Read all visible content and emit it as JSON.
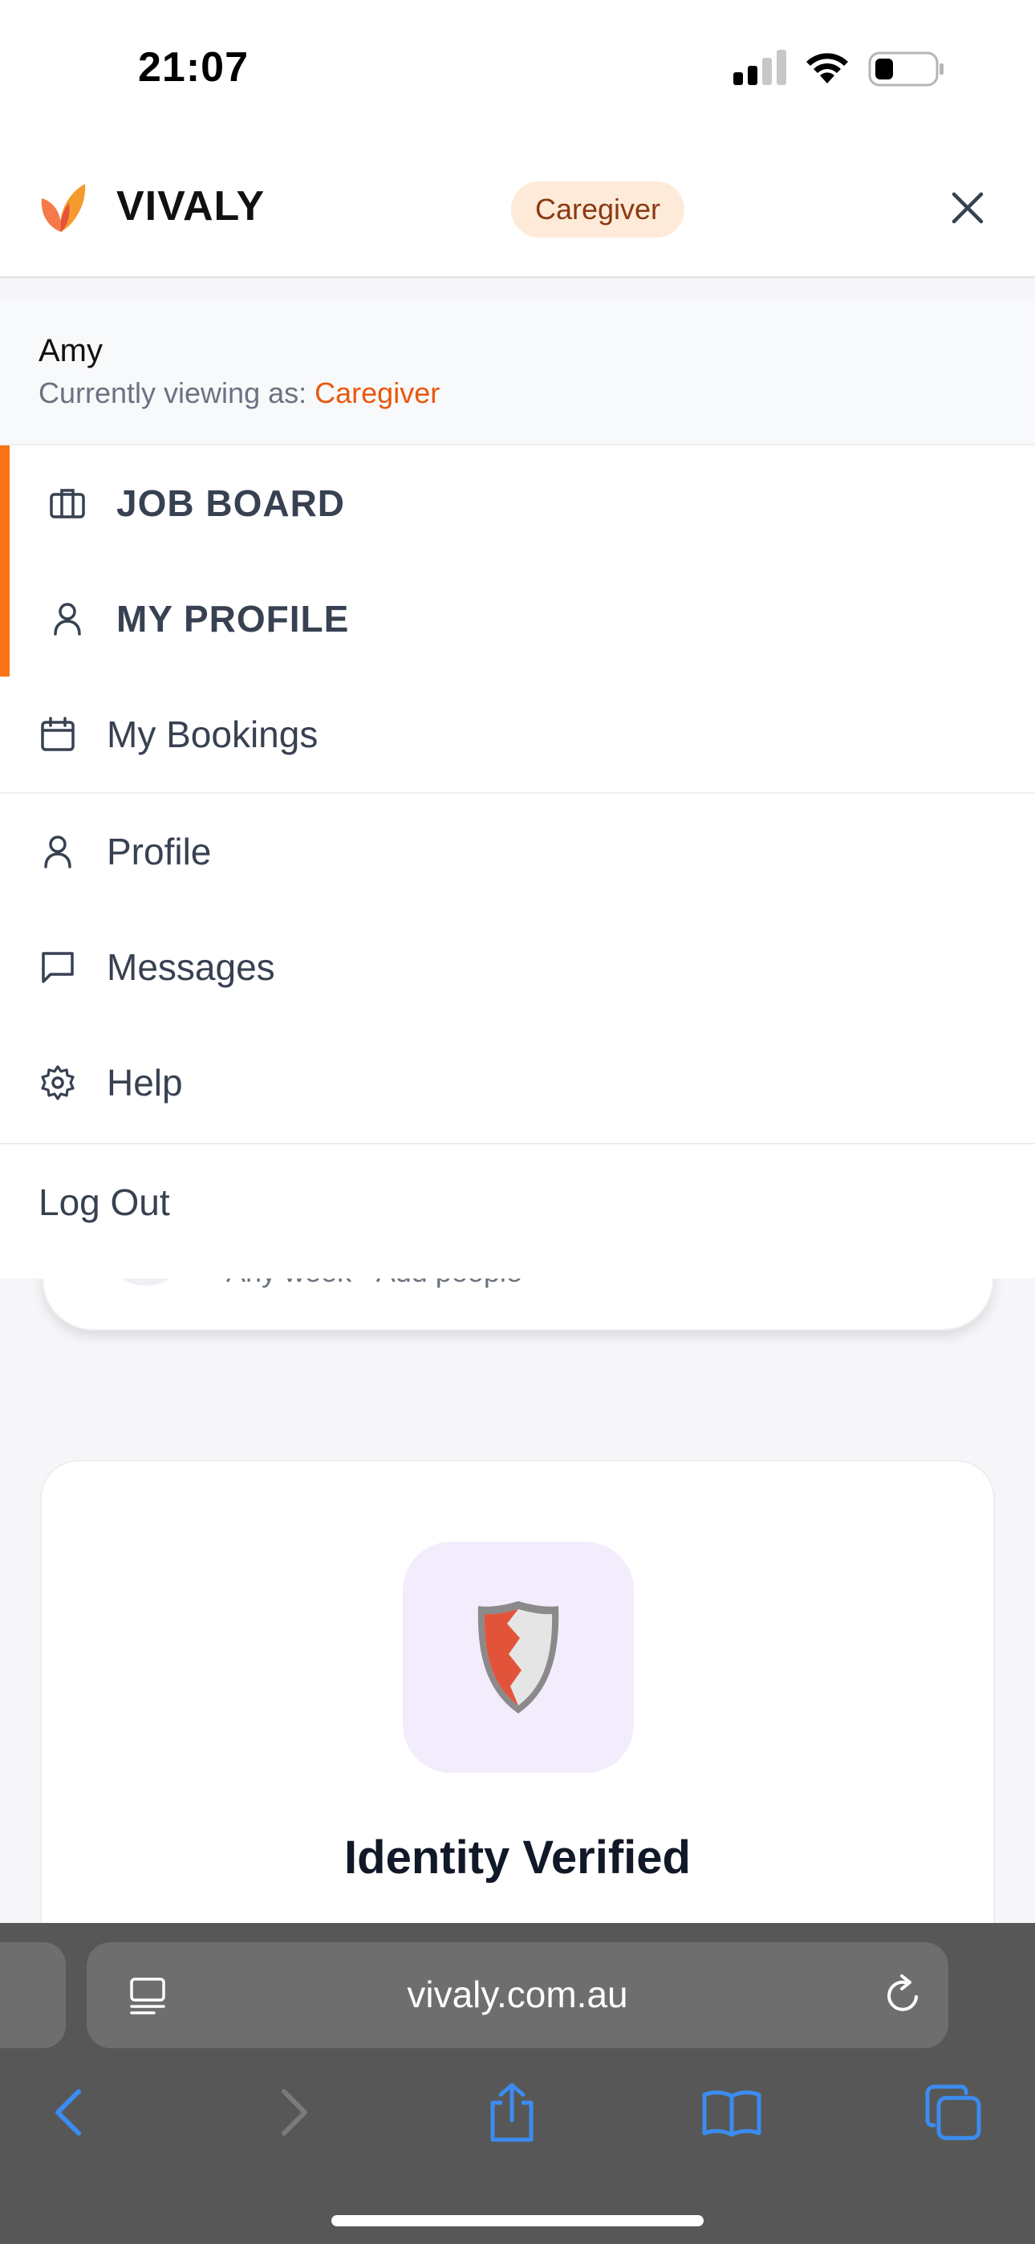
{
  "status_bar": {
    "time": "21:07"
  },
  "header": {
    "brand": "VIVALY",
    "role_badge": "Caregiver",
    "colors": {
      "accent": "#f97316",
      "badge_bg": "#feead8"
    }
  },
  "user": {
    "name": "Amy",
    "viewing_prefix": "Currently viewing as: ",
    "viewing_role": "Caregiver"
  },
  "menu": {
    "primary": [
      {
        "label": "JOB BOARD",
        "icon": "briefcase-icon",
        "active": true
      },
      {
        "label": "MY PROFILE",
        "icon": "user-icon",
        "active": true
      },
      {
        "label": "My Bookings",
        "icon": "calendar-icon",
        "active": false
      }
    ],
    "secondary": [
      {
        "label": "Profile",
        "icon": "user-icon"
      },
      {
        "label": "Messages",
        "icon": "message-icon"
      },
      {
        "label": "Help",
        "icon": "gear-icon"
      }
    ],
    "logout": "Log Out"
  },
  "background_page": {
    "search_subtitle": "Any week • Add people",
    "verify_title": "Identity Verified"
  },
  "browser": {
    "url": "vivaly.com.au"
  }
}
